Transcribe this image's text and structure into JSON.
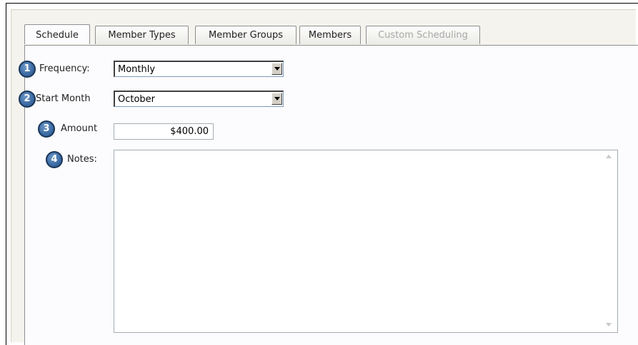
{
  "tabs": [
    {
      "label": "Schedule",
      "state": "active"
    },
    {
      "label": "Member Types",
      "state": "normal"
    },
    {
      "label": "Member Groups",
      "state": "normal"
    },
    {
      "label": "Members",
      "state": "normal"
    },
    {
      "label": "Custom Scheduling",
      "state": "disabled"
    }
  ],
  "form": {
    "frequency": {
      "badge": "1",
      "label": "Frequency:",
      "value": "Monthly"
    },
    "start_month": {
      "badge": "2",
      "label": "Start Month",
      "value": "October"
    },
    "amount": {
      "badge": "3",
      "label": "Amount",
      "value": "$400.00"
    },
    "notes": {
      "badge": "4",
      "label": "Notes:",
      "value": ""
    }
  },
  "icons": {
    "dropdown": "chevron-down-icon",
    "scroll_up": "scroll-up-arrow-icon",
    "scroll_down": "scroll-down-arrow-icon"
  },
  "colors": {
    "badge_fill": "#3b6aa3",
    "tab_border": "#8e8f8f",
    "disabled_text": "#a8a8a8"
  }
}
